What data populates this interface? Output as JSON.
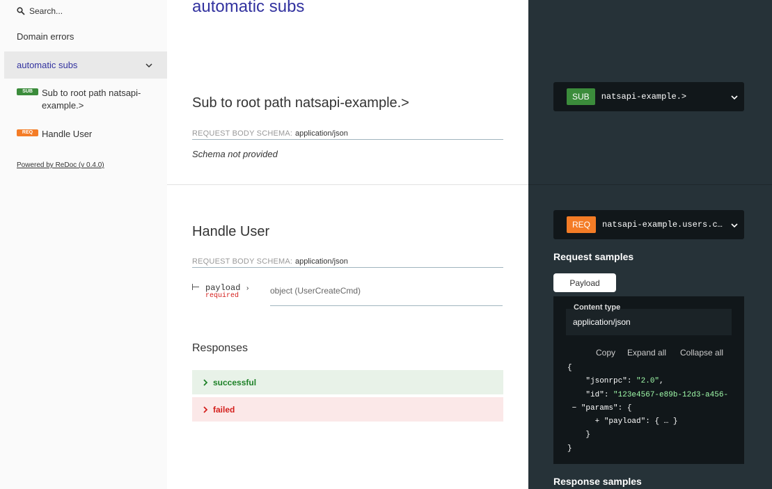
{
  "sidebar": {
    "search_placeholder": "Search...",
    "items": [
      {
        "label": "Domain errors"
      },
      {
        "label": "automatic subs"
      }
    ],
    "operations": [
      {
        "badge": "SUB",
        "label": "Sub to root path natsapi-example.>",
        "color": "#3b8c3b"
      },
      {
        "badge": "REQ",
        "label": "Handle User",
        "color": "#f47c26"
      }
    ],
    "powered_by": "Powered by ReDoc (v 0.4.0)"
  },
  "main": {
    "page_title": "automatic subs",
    "op1": {
      "title": "Sub to root path natsapi-example.>",
      "schema_label": "REQUEST BODY SCHEMA:",
      "schema_type": "application/json",
      "schema_note": "Schema not provided"
    },
    "op2": {
      "title": "Handle User",
      "schema_label": "REQUEST BODY SCHEMA:",
      "schema_type": "application/json",
      "param_name": "payload",
      "param_required": "required",
      "param_type": "object (UserCreateCmd)",
      "responses_title": "Responses",
      "responses": [
        {
          "label": "successful",
          "color": "#1d8127"
        },
        {
          "label": "failed",
          "color": "#d41f1c"
        }
      ]
    }
  },
  "right_panel": {
    "endpoint1": {
      "badge": "SUB",
      "path": "natsapi-example.>"
    },
    "endpoint2": {
      "badge": "REQ",
      "path": "natsapi-example.users.create"
    },
    "request_samples_title": "Request samples",
    "tab_label": "Payload",
    "content_type_label": "Content type",
    "content_type_value": "application/json",
    "actions": [
      "Copy",
      "Expand all",
      "Collapse all"
    ],
    "code": {
      "open": "{",
      "jsonrpc_key": "\"jsonrpc\"",
      "jsonrpc_val": "\"2.0\"",
      "id_key": "\"id\"",
      "id_val": "\"123e4567-e89b-12d3-a456-",
      "params_key": "\"params\"",
      "payload_key": "\"payload\"",
      "payload_val": "{ … }",
      "close": "}"
    },
    "response_samples_title": "Response samples"
  }
}
